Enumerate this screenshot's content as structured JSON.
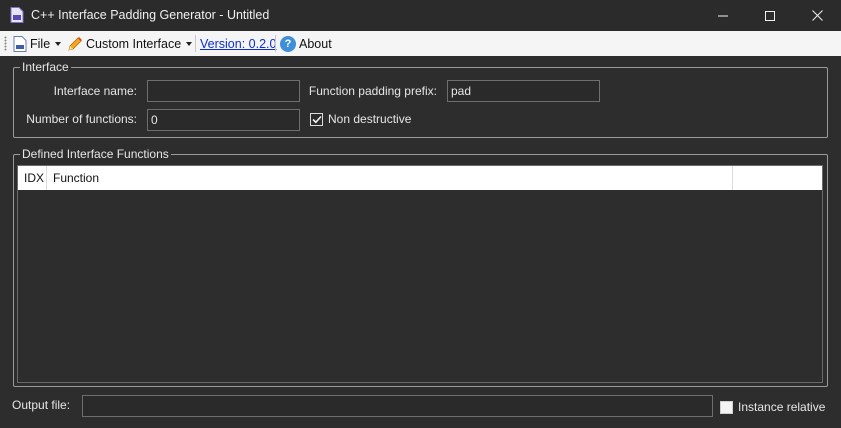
{
  "window": {
    "title": "C++ Interface Padding Generator - Untitled",
    "controls": [
      "minimize",
      "maximize",
      "close"
    ]
  },
  "menu": {
    "file": "File",
    "custom_interface": "Custom Interface",
    "version": "Version: 0.2.0",
    "about": "About"
  },
  "interface_group": {
    "title": "Interface",
    "name_label": "Interface name:",
    "name_value": "",
    "count_label": "Number of functions:",
    "count_value": "0",
    "prefix_label": "Function padding prefix:",
    "prefix_value": "pad",
    "non_destructive_label": "Non destructive",
    "non_destructive_checked": true
  },
  "functions_group": {
    "title": "Defined Interface Functions",
    "columns": [
      "IDX",
      "Function",
      ""
    ],
    "rows": []
  },
  "footer": {
    "output_label": "Output file:",
    "output_value": "",
    "instance_relative_label": "Instance relative",
    "instance_relative_checked": false
  },
  "colors": {
    "background": "#2d2d2d",
    "titlebar": "#2b2b2b",
    "menubar": "#f5f5f5",
    "link": "#0b2fd1",
    "help_icon": "#3f8fd8"
  },
  "icons": {
    "app": "document-icon",
    "file": "file-icon",
    "custom_interface": "pencil-icon",
    "about": "help-icon"
  }
}
